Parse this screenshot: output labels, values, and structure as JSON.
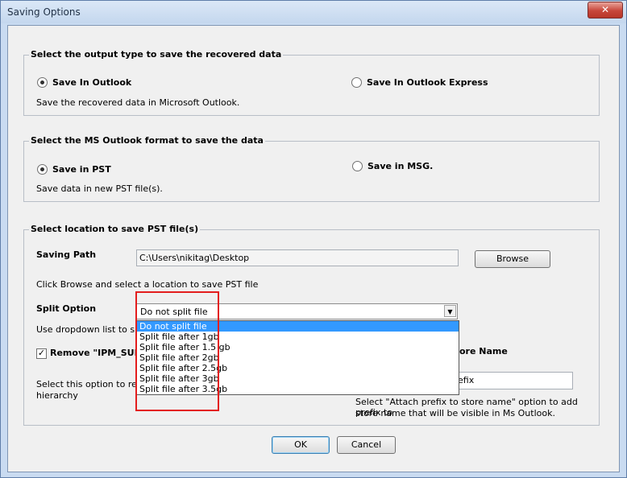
{
  "window": {
    "title": "Saving Options",
    "close_glyph": "✕"
  },
  "output_group": {
    "legend": "Select the output type to save the recovered data",
    "opt1": "Save In Outlook",
    "opt2": "Save In Outlook Express",
    "desc": "Save the recovered data in Microsoft Outlook."
  },
  "format_group": {
    "legend": "Select the MS Outlook format to save the data",
    "opt1": "Save in PST",
    "opt2": "Save in MSG.",
    "desc": "Save data in new PST file(s)."
  },
  "location_group": {
    "legend": "Select location to save PST file(s)",
    "path_label": "Saving Path",
    "path_value": "C:\\Users\\nikitag\\Desktop",
    "browse": "Browse",
    "browse_hint": "Click Browse and select a location to save PST file",
    "split_label": "Split Option",
    "split_value": "Do not split file",
    "split_hint": "Use dropdown list to split t",
    "split_options": [
      "Do not split file",
      "Split file after 1gb",
      "Split file after 1.5 gb",
      "Split file after 2gb",
      "Split file after 2.5gb",
      "Split file after 3gb",
      "Split file after 3.5gb"
    ],
    "remove_label": "Remove \"IPM_SUBTF",
    "remove_desc1": "Select this option to remov",
    "remove_desc2": "hierarchy",
    "store_name_label": "ore Name",
    "prefix_value": "efix",
    "prefix_hint1": "Select \"Attach prefix to store name\" option to add prefix to",
    "prefix_hint2": "store name that will be visible in Ms Outlook."
  },
  "buttons": {
    "ok": "OK",
    "cancel": "Cancel"
  },
  "colors": {
    "selection": "#3399ff",
    "highlight": "#e31d1d"
  }
}
